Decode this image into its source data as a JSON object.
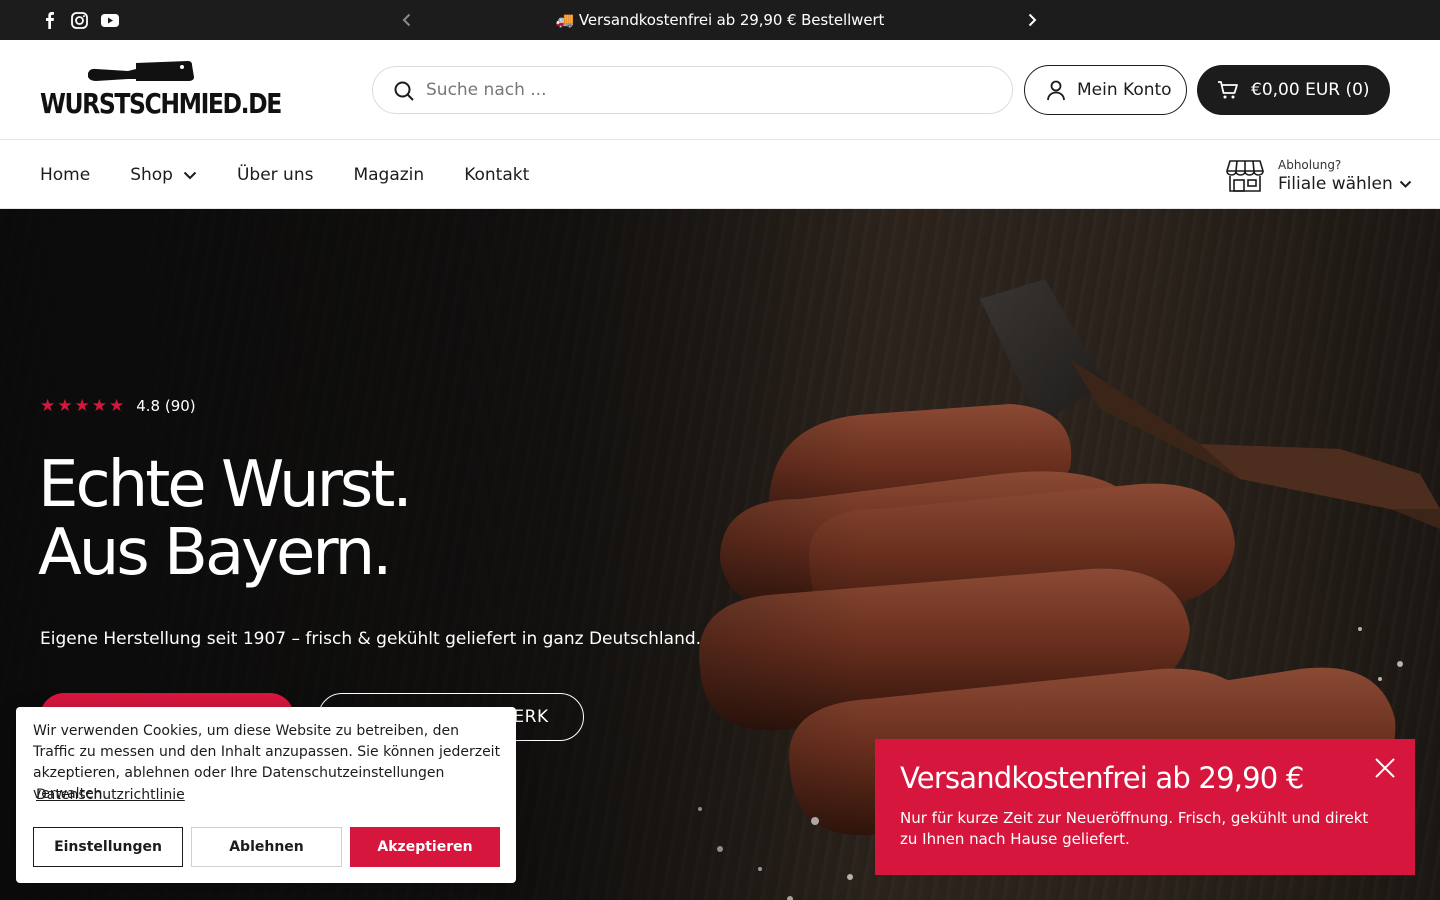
{
  "announcement": {
    "message": "🚚 Versandkostenfrei ab 29,90 € Bestellwert",
    "socials": [
      "facebook-icon",
      "instagram-icon",
      "youtube-icon"
    ]
  },
  "header": {
    "logo_text": "WURSTSCHMIED.DE",
    "search_placeholder": "Suche nach ...",
    "account_label": "Mein Konto",
    "cart_label": "€0,00 EUR (0)"
  },
  "nav": {
    "items": [
      {
        "label": "Home"
      },
      {
        "label": "Shop"
      },
      {
        "label": "Über uns"
      },
      {
        "label": "Magazin"
      },
      {
        "label": "Kontakt"
      }
    ],
    "pickup_label": "Abholung?",
    "pickup_value": "Filiale wählen"
  },
  "hero": {
    "rating_text": "4.8 (90)",
    "rating_value": 4.8,
    "rating_stars": 5,
    "headline_line1": "Echte Wurst.",
    "headline_line2": "Aus Bayern.",
    "subline": "Eigene Herstellung seit 1907 – frisch & gekühlt geliefert in ganz Deutschland.",
    "secondary_cta_visible": "ERK"
  },
  "cookie": {
    "text": "Wir verwenden Cookies, um diese Website zu betreiben, den Traffic zu messen und den Inhalt anzupassen. Sie können jederzeit akzeptieren, ablehnen oder Ihre Datenschutzeinstellungen verwalten.",
    "link": "Datenschutzrichtlinie",
    "settings": "Einstellungen",
    "decline": "Ablehnen",
    "accept": "Akzeptieren"
  },
  "promo": {
    "title": "Versandkostenfrei ab 29,90 €",
    "body": "Nur für kurze Zeit zur Neueröffnung. Frisch, gekühlt und direkt zu Ihnen nach Hause geliefert."
  },
  "colors": {
    "brand_red": "#d7163d",
    "dark": "#1c1c1c"
  }
}
